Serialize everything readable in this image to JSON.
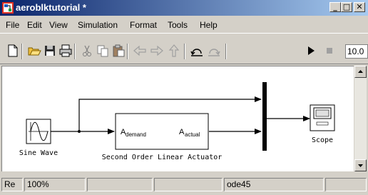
{
  "window": {
    "title": "aeroblktutorial *",
    "controls": {
      "minimize": "_",
      "maximize": "□",
      "close": "✕"
    }
  },
  "menu": {
    "items": [
      "File",
      "Edit",
      "View",
      "Simulation",
      "Format",
      "Tools",
      "Help"
    ]
  },
  "toolbar": {
    "icons": [
      "new-icon",
      "open-icon",
      "save-icon",
      "print-icon",
      "cut-icon",
      "copy-icon",
      "paste-icon",
      "back-icon",
      "forward-icon",
      "up-icon",
      "undo-icon",
      "redo-icon",
      "start-icon",
      "stop-icon"
    ],
    "stop_time": "10.0"
  },
  "diagram": {
    "blocks": {
      "sine_wave": {
        "label": "Sine Wave"
      },
      "actuator": {
        "label": "Second Order Linear Actuator",
        "input_port": {
          "letter": "A",
          "subscript": "demand"
        },
        "output_port": {
          "letter": "A",
          "subscript": "actual"
        }
      },
      "mux": {
        "label": ""
      },
      "scope": {
        "label": "Scope"
      }
    }
  },
  "status": {
    "ready": "Re",
    "zoom": "100%",
    "pane3": "",
    "pane4": "",
    "solver": "ode45",
    "pane6": ""
  },
  "colors": {
    "titlebar_start": "#0a246a",
    "titlebar_end": "#a6caf0",
    "chrome": "#d4d0c8",
    "canvas": "#ffffff"
  }
}
